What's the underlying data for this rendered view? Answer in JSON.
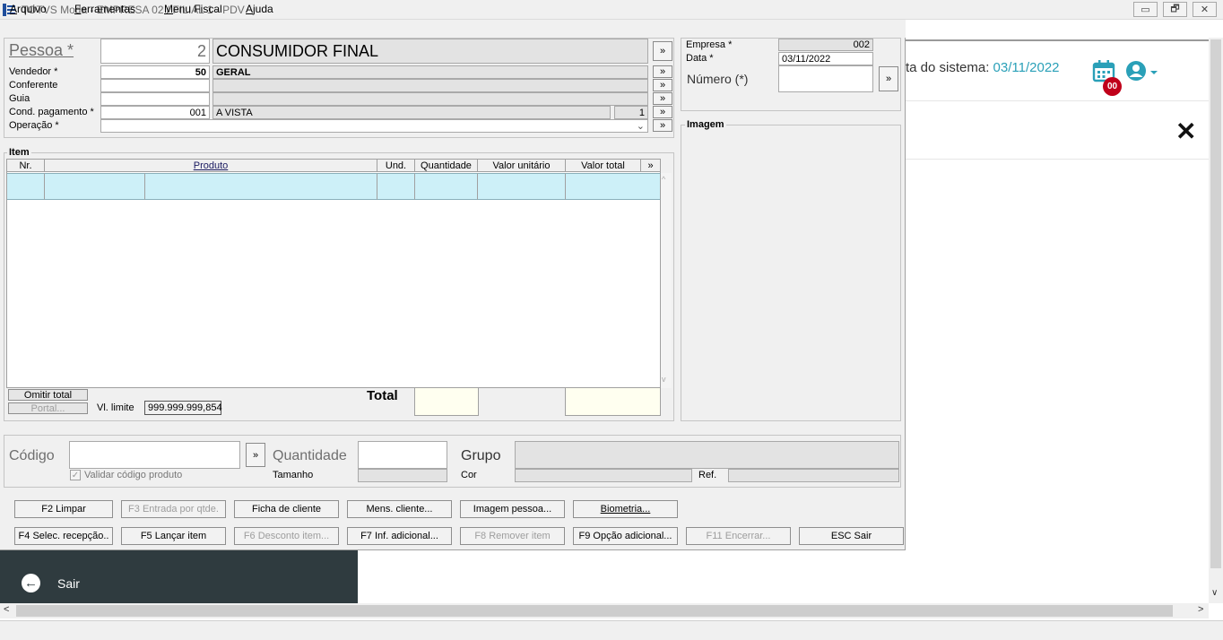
{
  "window": {
    "title": "TOTVS Moda - EMPRESA 02 / FILIAL 1 - PDV",
    "controls": {
      "minimize": "▭",
      "restore": "🗗",
      "close": "✕"
    }
  },
  "menu": [
    "Arquivo",
    "Ferramentas",
    "Menu Fiscal",
    "Ajuda"
  ],
  "background_app": {
    "date_label": "ta do sistema: ",
    "date_value": "03/11/2022",
    "badge": "00",
    "close": "✕",
    "sidebar_action": "Sair"
  },
  "header_form": {
    "pessoa_label": "Pessoa *",
    "pessoa_code": "2",
    "pessoa_name": "CONSUMIDOR FINAL",
    "vendedor_label": "Vendedor *",
    "vendedor_code": "50",
    "vendedor_name": "GERAL",
    "conferente_label": "Conferente",
    "guia_label": "Guia",
    "cond_label": "Cond. pagamento *",
    "cond_code": "001",
    "cond_name": "A VISTA",
    "cond_parcelas": "1",
    "operacao_label": "Operação *",
    "more": "»"
  },
  "right_panel": {
    "empresa_label": "Empresa *",
    "empresa_value": "002",
    "data_label": "Data *",
    "data_value": "03/11/2022",
    "numero_label": "Número (*)",
    "imagem_title": "Imagem"
  },
  "item_grid": {
    "title": "Item",
    "columns": [
      "Nr.",
      "Produto",
      "Und.",
      "Quantidade",
      "Valor unitário",
      "Valor total",
      "»"
    ],
    "omitir_total": "Omitir total",
    "portal": "Portal...",
    "vl_limite_label": "Vl. limite",
    "vl_limite_value": "999.999.999,854",
    "total_label": "Total"
  },
  "entry": {
    "codigo_label": "Código",
    "quantidade_label": "Quantidade",
    "grupo_label": "Grupo",
    "validar_label": "Validar código produto",
    "tamanho_label": "Tamanho",
    "cor_label": "Cor",
    "ref_label": "Ref."
  },
  "buttons_row1": [
    "F2 Limpar",
    "F3 Entrada por qtde.",
    "Ficha de cliente",
    "Mens. cliente...",
    "Imagem pessoa...",
    "Biometria..."
  ],
  "buttons_row2": [
    "F4 Selec. recepção..",
    "F5 Lançar item",
    "F6 Desconto item...",
    "F7 Inf. adicional...",
    "F8 Remover item",
    "F9 Opção adicional...",
    "F11 Encerrar...",
    "ESC Sair"
  ]
}
